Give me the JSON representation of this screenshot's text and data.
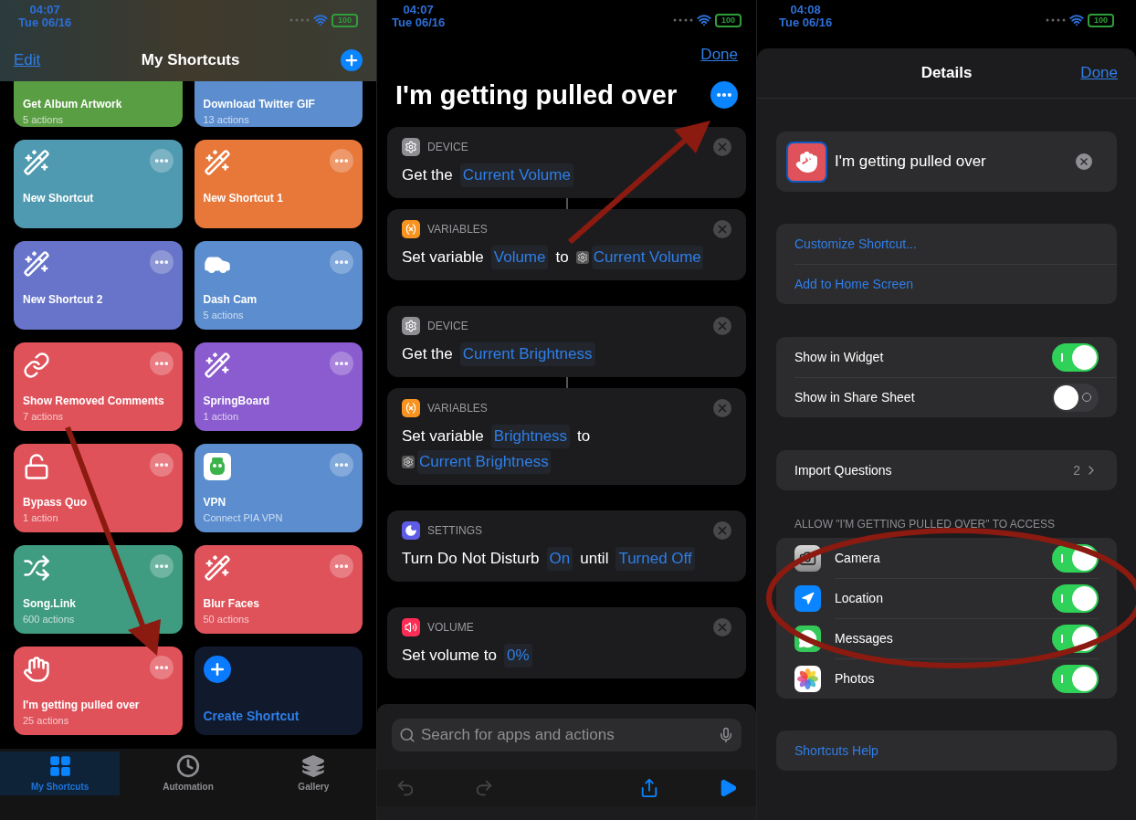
{
  "screens": [
    {
      "status_bar": {
        "time": "04:07",
        "date": "Tue 06/16",
        "battery": "100"
      },
      "nav": {
        "edit": "Edit",
        "title": "My Shortcuts"
      },
      "cards": [
        {
          "title": "Get Album Artwork",
          "subtitle": "5 actions",
          "color": "#5a9e44",
          "kind": "cropped",
          "more_button": false
        },
        {
          "title": "Download Twitter GIF",
          "subtitle": "13 actions",
          "color": "#5b8dcf",
          "kind": "cropped",
          "more_button": false
        },
        {
          "title": "New Shortcut",
          "color": "#4f9ab0",
          "kind": "wand",
          "more_button": true
        },
        {
          "title": "New Shortcut 1",
          "color": "#e8773a",
          "kind": "wand",
          "more_button": true
        },
        {
          "title": "New Shortcut 2",
          "color": "#6774c9",
          "kind": "wand",
          "more_button": true
        },
        {
          "title": "Dash Cam",
          "subtitle": "5 actions",
          "color": "#5b8dcf",
          "kind": "car",
          "more_button": true
        },
        {
          "title": "Show Removed Comments",
          "subtitle": "7 actions",
          "color": "#e0525a",
          "kind": "link",
          "more_button": true
        },
        {
          "title": "SpringBoard",
          "subtitle": "1 action",
          "color": "#8b5ccf",
          "kind": "wand",
          "more_button": true
        },
        {
          "title": "Bypass Quo",
          "subtitle": "1 action",
          "color": "#e0525a",
          "kind": "lock",
          "more_button": true
        },
        {
          "title": "VPN",
          "subtitle": "Connect PIA VPN",
          "color": "#5b8dcf",
          "kind": "vpn",
          "more_button": true
        },
        {
          "title": "Song.Link",
          "subtitle": "600 actions",
          "color": "#3f9c80",
          "kind": "shuffle",
          "more_button": true
        },
        {
          "title": "Blur Faces",
          "subtitle": "50 actions",
          "color": "#e0525a",
          "kind": "wand",
          "more_button": true
        },
        {
          "title": "I'm getting pulled over",
          "subtitle": "25 actions",
          "color": "#e0525a",
          "kind": "hand",
          "more_button": true
        },
        {
          "title": "Create Shortcut",
          "kind": "create",
          "color": "#101a2c",
          "more_button": false
        }
      ],
      "tabs": [
        {
          "label": "My Shortcuts",
          "kind": "grid",
          "selected": true
        },
        {
          "label": "Automation",
          "kind": "clock",
          "selected": false
        },
        {
          "label": "Gallery",
          "kind": "layers",
          "selected": false
        }
      ]
    },
    {
      "status_bar": {
        "time": "04:07",
        "date": "Tue 06/16",
        "battery": "100"
      },
      "done": "Done",
      "title": "I'm getting pulled over",
      "actions": [
        {
          "category": "DEVICE",
          "kind": "gear",
          "color": "#8e8e93",
          "linked": true,
          "parts": [
            {
              "text": "Get the",
              "kind": "plain"
            },
            {
              "text": "Current Volume",
              "kind": "token"
            }
          ]
        },
        {
          "category": "VARIABLES",
          "kind": "variable",
          "color": "#f7931e",
          "linked": false,
          "parts": [
            {
              "text": "Set variable",
              "kind": "plain"
            },
            {
              "text": "Volume",
              "kind": "token"
            },
            {
              "text": "to",
              "kind": "plain"
            },
            {
              "text": "Current Volume",
              "kind": "variable"
            }
          ]
        },
        {
          "category": "DEVICE",
          "kind": "gear",
          "color": "#8e8e93",
          "linked": true,
          "parts": [
            {
              "text": "Get the",
              "kind": "plain"
            },
            {
              "text": "Current Brightness",
              "kind": "token"
            }
          ]
        },
        {
          "category": "VARIABLES",
          "kind": "variable",
          "color": "#f7931e",
          "linked": false,
          "parts": [
            {
              "text": "Set variable",
              "kind": "plain"
            },
            {
              "text": "Brightness",
              "kind": "token"
            },
            {
              "text": "to",
              "kind": "plain"
            },
            {
              "text": "Current Brightness",
              "kind": "variable"
            }
          ]
        },
        {
          "category": "SETTINGS",
          "kind": "moon",
          "color": "#5e5ce6",
          "linked": false,
          "parts": [
            {
              "text": "Turn Do Not Disturb",
              "kind": "plain"
            },
            {
              "text": "On",
              "kind": "token"
            },
            {
              "text": "until",
              "kind": "plain"
            },
            {
              "text": "Turned Off",
              "kind": "token"
            }
          ]
        },
        {
          "category": "VOLUME",
          "kind": "volume",
          "color": "#ff2d55",
          "linked": false,
          "parts": [
            {
              "text": "Set volume to",
              "kind": "plain"
            },
            {
              "text": "0%",
              "kind": "token"
            }
          ]
        }
      ],
      "search": {
        "placeholder": "Search for apps and actions"
      }
    },
    {
      "status_bar": {
        "time": "04:08",
        "date": "Tue 06/16",
        "battery": "100"
      },
      "header": {
        "title": "Details",
        "done": "Done"
      },
      "name_field": {
        "value": "I'm getting pulled over"
      },
      "links": [
        "Customize Shortcut...",
        "Add to Home Screen"
      ],
      "toggles": [
        {
          "label": "Show in Widget",
          "on": true
        },
        {
          "label": "Show in Share Sheet",
          "on": false
        }
      ],
      "import_questions": {
        "label": "Import Questions",
        "count": "2"
      },
      "permissions_header": "ALLOW \"I'M GETTING PULLED OVER\" TO ACCESS",
      "permissions": [
        {
          "label": "Camera",
          "kind": "camera",
          "on": true
        },
        {
          "label": "Location",
          "kind": "location",
          "on": true
        },
        {
          "label": "Messages",
          "kind": "messages",
          "on": true
        },
        {
          "label": "Photos",
          "kind": "photos",
          "on": true
        }
      ],
      "help": "Shortcuts Help"
    }
  ]
}
